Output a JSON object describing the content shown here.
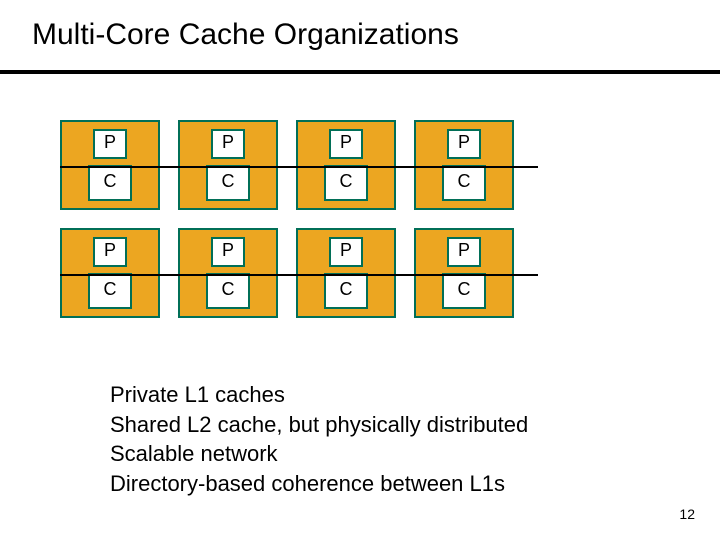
{
  "title": "Multi-Core Cache Organizations",
  "page_number": "12",
  "labels": {
    "proc": "P",
    "cache": "C"
  },
  "caption": {
    "l1": "Private L1 caches",
    "l2": "Shared L2 cache, but physically distributed",
    "l3": "Scalable network",
    "l4": "Directory-based coherence between L1s"
  },
  "chart_data": {
    "type": "diagram",
    "description": "2x4 grid of tiles; each tile contains a processor (P) and a cache (C); horizontal interconnect lines connect tiles in each row",
    "rows": 2,
    "cols": 4,
    "tile_components": [
      "P",
      "C"
    ],
    "interconnect": "horizontal bus per row"
  }
}
